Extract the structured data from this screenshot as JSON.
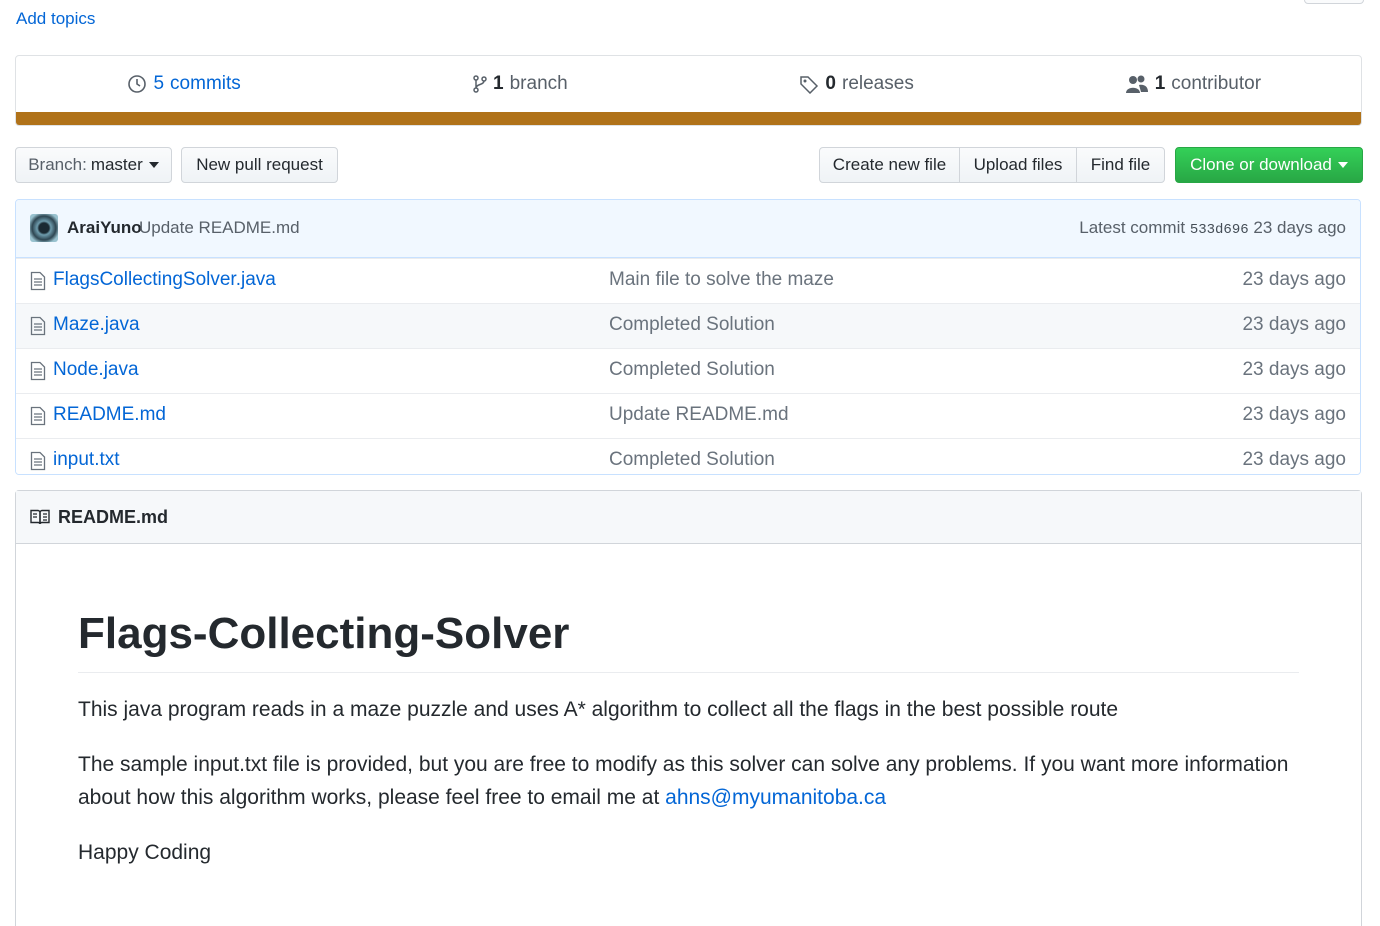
{
  "topics": {
    "add_label": "Add topics"
  },
  "summary": {
    "commits": {
      "count": "5",
      "label": "commits"
    },
    "branches": {
      "count": "1",
      "label": "branch"
    },
    "releases": {
      "count": "0",
      "label": "releases"
    },
    "contributors": {
      "count": "1",
      "label": "contributor"
    },
    "language_color": "#b07219"
  },
  "toolbar": {
    "branch_prefix": "Branch:",
    "branch_name": "master",
    "new_pr": "New pull request",
    "create_file": "Create new file",
    "upload_files": "Upload files",
    "find_file": "Find file",
    "clone": "Clone or download"
  },
  "latest_commit": {
    "author": "AraiYuno",
    "message": "Update README.md",
    "prefix": "Latest commit",
    "sha": "533d696",
    "age": "23 days ago"
  },
  "files": [
    {
      "name": "FlagsCollectingSolver.java",
      "message": "Main file to solve the maze",
      "age": "23 days ago"
    },
    {
      "name": "Maze.java",
      "message": "Completed Solution",
      "age": "23 days ago"
    },
    {
      "name": "Node.java",
      "message": "Completed Solution",
      "age": "23 days ago"
    },
    {
      "name": "README.md",
      "message": "Update README.md",
      "age": "23 days ago"
    },
    {
      "name": "input.txt",
      "message": "Completed Solution",
      "age": "23 days ago"
    }
  ],
  "readme": {
    "filename": "README.md",
    "title": "Flags-Collecting-Solver",
    "p1": "This java program reads in a maze puzzle and uses A* algorithm to collect all the flags in the best possible route",
    "p2_text": "The sample input.txt file is provided, but you are free to modify as this solver can solve any problems. If you want more information about how this algorithm works, please feel free to email me at",
    "p2_link": "ahns@myumanitoba.ca",
    "p3": "Happy Coding"
  }
}
